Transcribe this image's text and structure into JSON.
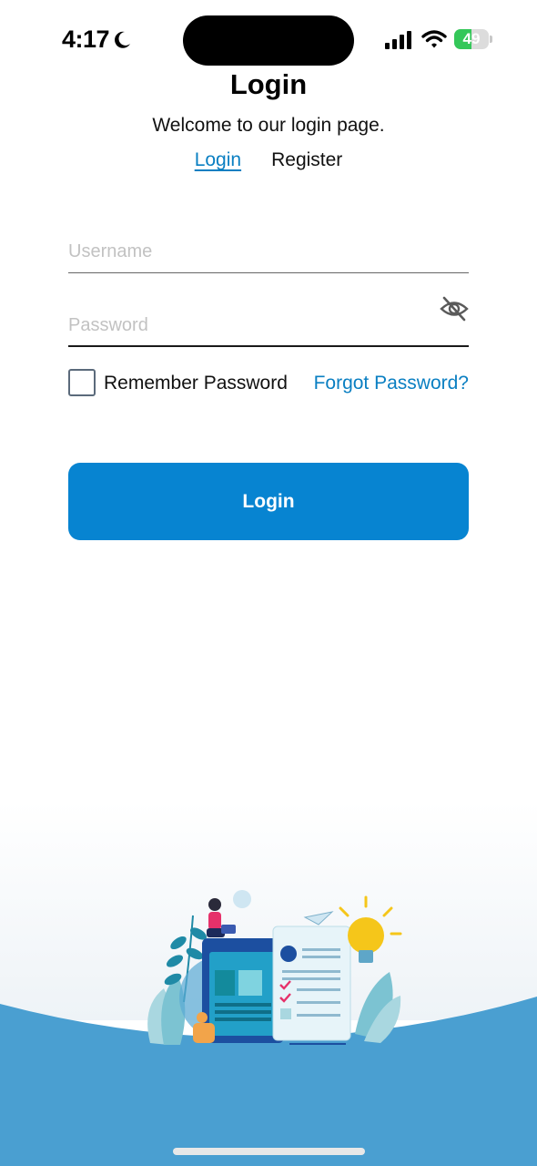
{
  "status_bar": {
    "time": "4:17",
    "battery_level": "49",
    "battery_fraction": 0.49,
    "icons": [
      "moon-icon",
      "cellular-signal-icon",
      "wifi-icon",
      "battery-icon"
    ]
  },
  "header": {
    "title": "Login",
    "subtitle": "Welcome to our login page."
  },
  "tabs": {
    "login": "Login",
    "register": "Register",
    "active": "login"
  },
  "form": {
    "username_placeholder": "Username",
    "username_value": "",
    "password_placeholder": "Password",
    "password_value": "",
    "password_toggle_icon": "eye-slash-icon",
    "remember_label": "Remember Password",
    "remember_checked": false,
    "forgot_link": "Forgot Password?",
    "submit_label": "Login"
  },
  "colors": {
    "accent": "#0784d1",
    "link": "#0a7fc2",
    "wave": "#4a9fd1",
    "battery_green": "#34c759"
  }
}
